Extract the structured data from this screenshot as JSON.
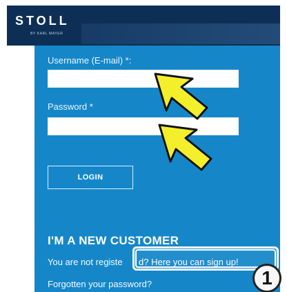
{
  "top_text": "",
  "header": {
    "brand": "STOLL",
    "brand_sub": "BY KARL MAYER"
  },
  "login": {
    "username_label": "Username (E-mail) *:",
    "password_label": "Password *",
    "login_button": "LOGIN"
  },
  "new_customer": {
    "title": "I'M A NEW CUSTOMER",
    "prefix_text": "You are not registe",
    "signup_link": "d? Here you can sign up!",
    "forgot_link": "Forgotten your password?"
  },
  "annotation": {
    "badge_number": "1"
  },
  "colors": {
    "header": "#0e2f55",
    "panel": "#1587c9",
    "arrow": "#f3ef2b"
  },
  "icons": {
    "arrow_1": "arrow-icon",
    "arrow_2": "arrow-icon"
  }
}
